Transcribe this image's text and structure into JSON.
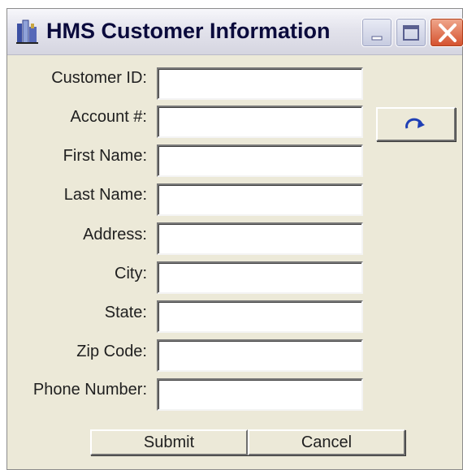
{
  "window": {
    "title": "HMS Customer Information",
    "icons": {
      "app": "app-icon",
      "minimize": "minimize-icon",
      "maximize": "maximize-icon",
      "close": "close-icon"
    },
    "colors": {
      "face": "#ECE9D8",
      "close": "#D4502C",
      "refresh_arrow": "#1F3FB5"
    }
  },
  "form": {
    "fields": [
      {
        "label": "Customer ID:",
        "value": ""
      },
      {
        "label": "Account #:",
        "value": ""
      },
      {
        "label": "First Name:",
        "value": ""
      },
      {
        "label": "Last Name:",
        "value": ""
      },
      {
        "label": "Address:",
        "value": ""
      },
      {
        "label": "City:",
        "value": ""
      },
      {
        "label": "State:",
        "value": ""
      },
      {
        "label": "Zip Code:",
        "value": ""
      },
      {
        "label": "Phone Number:",
        "value": ""
      }
    ],
    "refresh_icon": "redo-icon"
  },
  "buttons": {
    "submit": "Submit",
    "cancel": "Cancel"
  }
}
